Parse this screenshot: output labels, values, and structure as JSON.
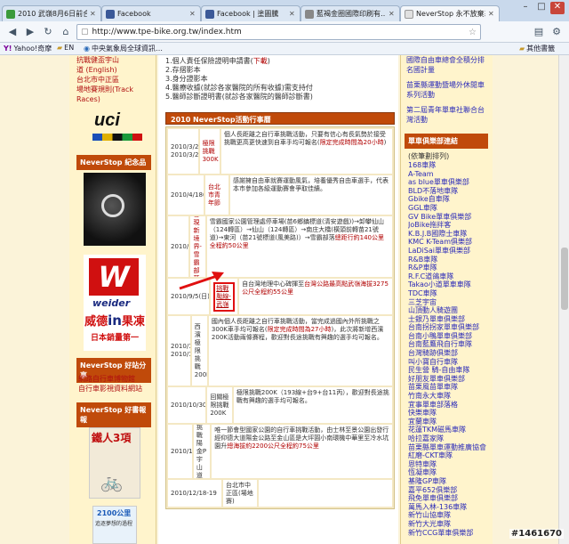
{
  "tabs": [
    {
      "title": "2010 武嶺8月6日前合…",
      "color": "#3b9a3b",
      "active": false
    },
    {
      "title": "Facebook",
      "color": "#3b5998",
      "active": false
    },
    {
      "title": "Facebook | 塗圖騰",
      "color": "#3b5998",
      "active": false
    },
    {
      "title": "藍褐金圈國際印刷有…",
      "color": "#888888",
      "active": false
    },
    {
      "title": "NeverStop 永不放棄系…",
      "color": "#e0e0e0",
      "active": true
    }
  ],
  "toolbar": {
    "url": "http://www.tpe-bike.org.tw/index.htm"
  },
  "bookmarks": [
    {
      "label": "Yahoo!奇摩"
    },
    {
      "label": "EN"
    },
    {
      "label": "中央氣象局全球資訊…"
    },
    {
      "label": "其他書籤"
    }
  ],
  "left": {
    "links_top": [
      "抗戰健盃宇山",
      "道 (English)",
      "台北市中正區",
      "場地賽規則(Track",
      "Races)"
    ],
    "uci_logo": "uci",
    "heading_souvenir": "NeverStop 紀念品",
    "weider_brand": "weider",
    "weider_slogan1": "威德",
    "weider_in": "in",
    "weider_slogan2": "果凍",
    "weider_slogan3": "日本銷量第一",
    "heading_share": "NeverStop 好站分享",
    "share_links": [
      "網路自行車博物館",
      "自行車影視資料網站"
    ],
    "heading_books": "NeverStop 好書報報",
    "book_title": "鐵人3項",
    "book_sub": "2100公里",
    "book_note": "追逐夢想的過程"
  },
  "notes": {
    "items": [
      {
        "text": "1.個人責任保險證明申請書(",
        "link": "下載",
        "tail": ")"
      },
      {
        "text": "2.存摺影本",
        "link": "",
        "tail": ""
      },
      {
        "text": "3.身分證影本",
        "link": "",
        "tail": ""
      },
      {
        "text": "4.醫療收據(就診各家醫院的所有收據)需支持付",
        "link": "",
        "tail": ""
      },
      {
        "text": "5.醫師診斷證明書(就診各家醫院的醫師診斷書)",
        "link": "",
        "tail": ""
      }
    ]
  },
  "schedule": {
    "heading": "2010 NeverStop活動行事曆",
    "rows": [
      {
        "date": "2010/3/27(六)\n2010/3/28(日)",
        "name": "極限挑戰300K",
        "desc": "個人長距離之自行車挑戰活動，只要有信心有長氣勢於接受挑戰更高更快速到自車手均可報名(",
        "hl": "限定完成時間為20小時",
        "tail": ")"
      },
      {
        "date": "2010/4/18(日)",
        "name": "台北市青年節",
        "desc": "感謝擁自由車就賽運動風氣，培養優秀自由車選手，代表本市參加各級運動賽會爭取佳績。",
        "hl": "",
        "tail": ""
      },
      {
        "date": "2010/6/13(日)",
        "name": "發現新境界-雪霸部落",
        "desc": "雪霸國家公園管理處停車場(苗6鄉鎮標道(清安遊戲))→卸攀仙山（124轉區）→仙山（124轉區）→南庄大橋(橫頭前轉苗21號道)→東河（苗21號標道(風美路)）→雪霸部落",
        "hl": "總距行約140公里全程約50公里",
        "tail": ""
      },
      {
        "date": "2010/9/5(日)",
        "name": "挑戰颱線-武嶺",
        "desc": "自台灣地理中心碑揮至",
        "hl": "台灣公路最高點武嶺海拔3275公尺全程約55公里",
        "tail": ""
      },
      {
        "date": "2010/10/2(六)\n2010/10/3(日)",
        "name": "西濱極限挑戰200K/400K",
        "desc": "國內個人長距離之自行車挑戰活動，當完成過國內外所挑戰之300K車手均可報名(",
        "hl": "限定完成時間為27小時",
        "tail": ")，此次將新增西濱200K活動兩條賽程，歡迎對長途挑戰有興趣的選手均可報名。"
      },
      {
        "date": "2010/10/30(六)",
        "name": "回關極限挑戰200K",
        "desc": "極限挑戰200K（193線+台9+台11丙），歡迎對長途挑戰有興趣的選手均可報名。",
        "hl": "",
        "tail": ""
      },
      {
        "date": "2010/12/5(日)",
        "name": "挑戰陽金P宇山道",
        "desc": "唯一節會型國家公園的自行車挑戰活動，由士林至景公園出發行經仰德大道陽金公路至金山區是大坪圓小南環機中華里至冷水坑園升",
        "hl": "總海拔約2200公尺全程約75公里",
        "tail": ""
      },
      {
        "date": "2010/12/18-19",
        "name": "台北市中正區(場地賽)",
        "desc": "",
        "hl": "",
        "tail": ""
      }
    ]
  },
  "right": {
    "top_links": [
      "國際自由車總會全積分排名國計量",
      "苗栗縣運動暨場外休閒車系列活動",
      "第二屆青年單車社聯合台灣活動"
    ],
    "heading_clubs": "單車俱樂部連結",
    "clubs_note": "(依筆劃排列)",
    "clubs": [
      "168車隊",
      "A-Team",
      "as blue單車俱樂部",
      "BLD不落地車隊",
      "Gbike自車隊",
      "GGL車隊",
      "GV Bike單車俱樂部",
      "JoBike拖拌客",
      "K.B.J.B國際士車隊",
      "KMC K-Team俱樂部",
      "LaDiSai單車俱樂部",
      "R&B車隊",
      "R&P車隊",
      "R.F.C道鴿車隊",
      "Takao小道單車車隊",
      "TDC車隊",
      "三芝宇宙",
      "山頂動人騎遊團",
      "士銀乃單車俱樂部",
      "台南拐拐家單車俱樂部",
      "台南小鴨單車俱樂部",
      "台南藍鷹飛自行車隊",
      "台灣騎跡俱樂部",
      "叫小寶自行車隊",
      "民生營 騎-自由車隊",
      "好朋友單車俱樂部",
      "苗栗風苗單車隊",
      "竹南永大車隊",
      "宜事單車部落格",
      "快樂車隊",
      "宜蘭車隊",
      "花蓮TKM磁馬車隊",
      "哈拉嘉家隊",
      "苗栗縣單車運動推廣協會",
      "紅磨-CKT車隊",
      "恩特車隊",
      "恆凝車隊",
      "基隆GP車隊",
      "嘉平652俱樂部",
      "飛免單車俱樂部",
      "萬馬入林-136車隊",
      "新竹山協車隊",
      "新竹大光車隊",
      "新竹CCG單車俱樂部"
    ]
  },
  "watermark": "#1461670"
}
